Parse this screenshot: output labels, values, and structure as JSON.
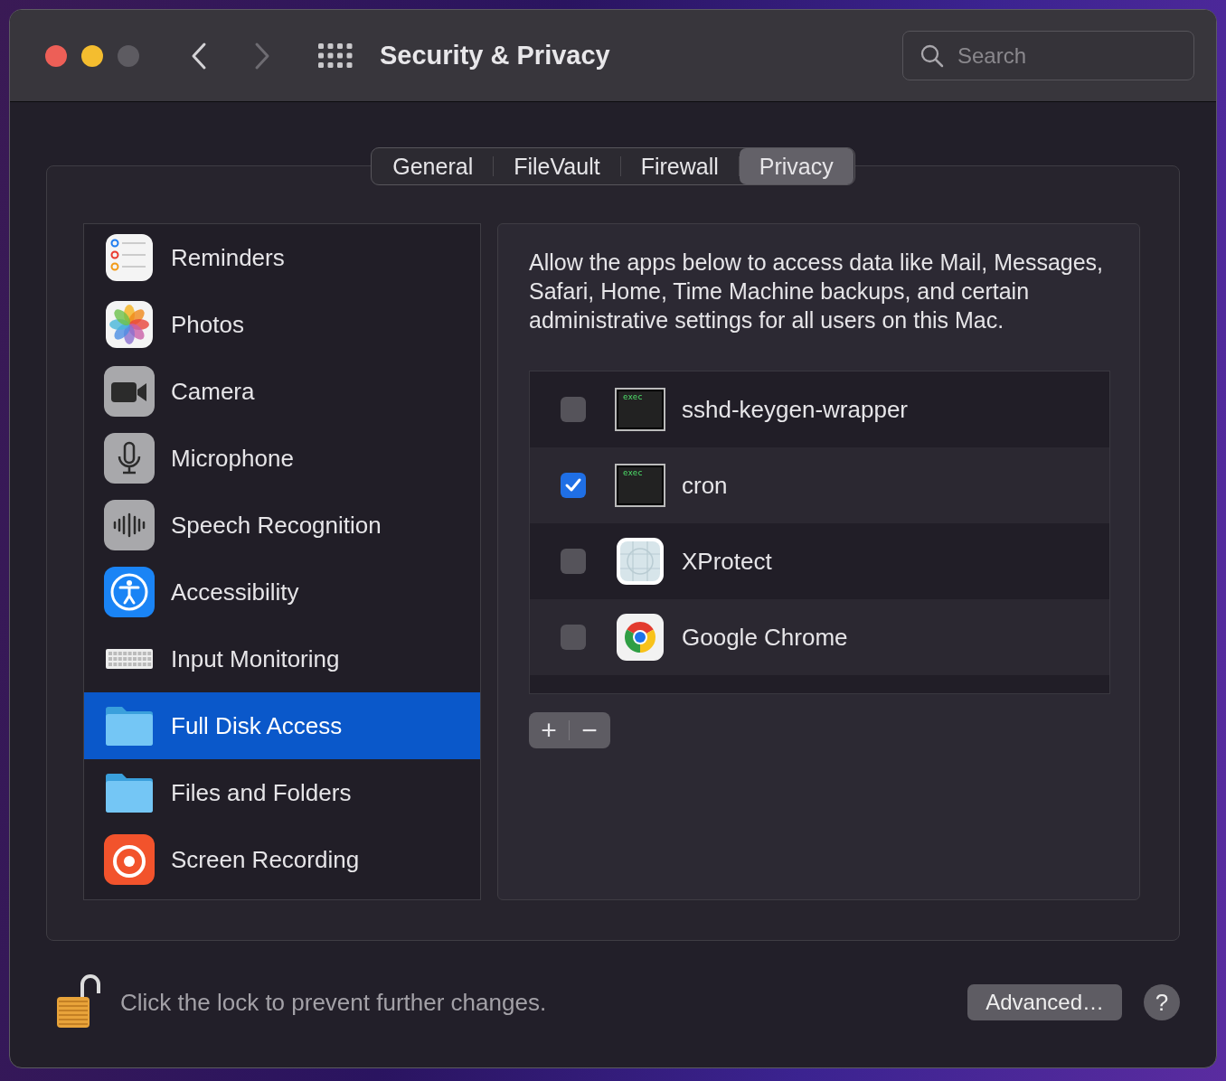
{
  "window": {
    "title": "Security & Privacy"
  },
  "search": {
    "placeholder": "Search"
  },
  "tabs": [
    {
      "label": "General",
      "selected": false
    },
    {
      "label": "FileVault",
      "selected": false
    },
    {
      "label": "Firewall",
      "selected": false
    },
    {
      "label": "Privacy",
      "selected": true
    }
  ],
  "categories": [
    {
      "label": "Reminders",
      "kind": "reminders",
      "selected": false
    },
    {
      "label": "Photos",
      "kind": "photos",
      "selected": false
    },
    {
      "label": "Camera",
      "kind": "camera",
      "selected": false
    },
    {
      "label": "Microphone",
      "kind": "microphone",
      "selected": false
    },
    {
      "label": "Speech Recognition",
      "kind": "speech",
      "selected": false
    },
    {
      "label": "Accessibility",
      "kind": "accessibility",
      "selected": false
    },
    {
      "label": "Input Monitoring",
      "kind": "keyboard",
      "selected": false
    },
    {
      "label": "Full Disk Access",
      "kind": "folder",
      "selected": true
    },
    {
      "label": "Files and Folders",
      "kind": "folder",
      "selected": false
    },
    {
      "label": "Screen Recording",
      "kind": "record",
      "selected": false
    }
  ],
  "description": "Allow the apps below to access data like Mail, Messages, Safari, Home, Time Machine backups, and certain administrative settings for all users on this Mac.",
  "apps": [
    {
      "name": "sshd-keygen-wrapper",
      "kind": "exec",
      "checked": false,
      "badge": "exec"
    },
    {
      "name": "cron",
      "kind": "exec",
      "checked": true,
      "badge": "exec"
    },
    {
      "name": "XProtect",
      "kind": "xprotect",
      "checked": false
    },
    {
      "name": "Google Chrome",
      "kind": "chrome",
      "checked": false
    }
  ],
  "list_buttons": [
    "+",
    "−"
  ],
  "lock_message": "Click the lock to prevent further changes.",
  "advanced_button": "Advanced…",
  "help_button": "?"
}
